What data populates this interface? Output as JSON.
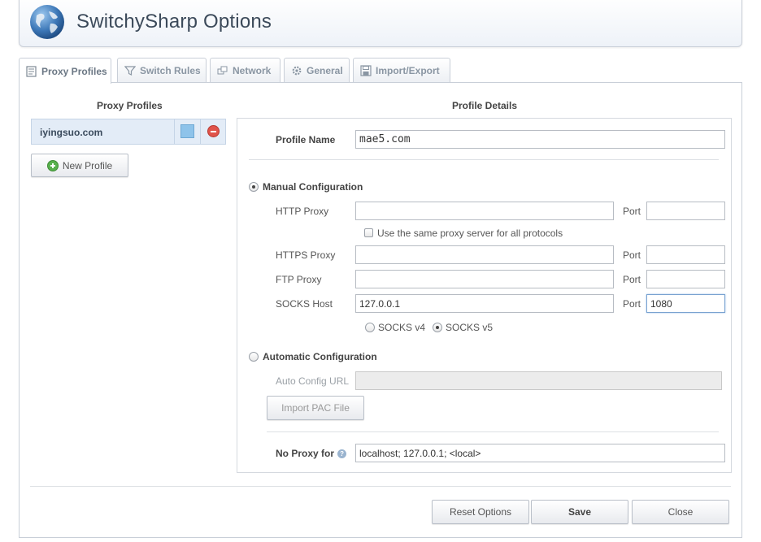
{
  "app": {
    "title": "SwitchySharp Options"
  },
  "tabs": [
    {
      "label": "Proxy Profiles",
      "icon": "profiles-icon"
    },
    {
      "label": "Switch Rules",
      "icon": "filter-icon"
    },
    {
      "label": "Network",
      "icon": "network-icon"
    },
    {
      "label": "General",
      "icon": "gear-icon"
    },
    {
      "label": "Import/Export",
      "icon": "disk-icon"
    }
  ],
  "profiles": {
    "heading": "Proxy Profiles",
    "items": [
      {
        "name": "iyingsuo.com",
        "color": "#8ec3ea"
      }
    ],
    "new_button": "New Profile"
  },
  "details": {
    "heading": "Profile Details",
    "profile_name_label": "Profile Name",
    "profile_name_value": " mae5.com",
    "manual_label": "Manual Configuration",
    "http_label": "HTTP Proxy",
    "http_value": "",
    "port_label": "Port",
    "http_port": "",
    "same_proxy_label": "Use the same proxy server for all protocols",
    "https_label": "HTTPS Proxy",
    "https_value": "",
    "https_port": "",
    "ftp_label": "FTP Proxy",
    "ftp_value": "",
    "ftp_port": "",
    "socks_label": "SOCKS Host",
    "socks_value": "127.0.0.1",
    "socks_port": "1080",
    "socks_v4_label": "SOCKS v4",
    "socks_v5_label": "SOCKS v5",
    "auto_label": "Automatic Configuration",
    "auto_url_label": "Auto Config URL",
    "auto_url_value": "",
    "import_pac_button": "Import PAC File",
    "no_proxy_label": "No Proxy for",
    "no_proxy_value": "localhost; 127.0.0.1; <local>"
  },
  "footer": {
    "reset_button": "Reset Options",
    "save_button": "Save",
    "close_button": "Close"
  }
}
